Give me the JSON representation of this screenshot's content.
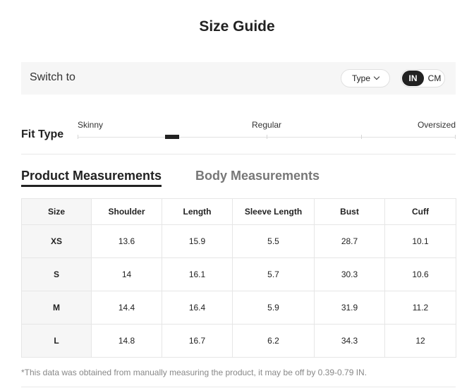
{
  "title": "Size Guide",
  "switch_bar": {
    "label": "Switch to",
    "type_button": "Type",
    "units": {
      "in": "IN",
      "cm": "CM",
      "selected": "IN"
    }
  },
  "fit_type": {
    "label": "Fit Type",
    "options": [
      "Skinny",
      "Regular",
      "Oversized"
    ],
    "selected_segment": 1,
    "segment_count": 4
  },
  "tabs": {
    "product": "Product Measurements",
    "body": "Body Measurements",
    "active": "product"
  },
  "table": {
    "headers": [
      "Size",
      "Shoulder",
      "Length",
      "Sleeve Length",
      "Bust",
      "Cuff"
    ],
    "rows": [
      [
        "XS",
        "13.6",
        "15.9",
        "5.5",
        "28.7",
        "10.1"
      ],
      [
        "S",
        "14",
        "16.1",
        "5.7",
        "30.3",
        "10.6"
      ],
      [
        "M",
        "14.4",
        "16.4",
        "5.9",
        "31.9",
        "11.2"
      ],
      [
        "L",
        "14.8",
        "16.7",
        "6.2",
        "34.3",
        "12"
      ]
    ]
  },
  "footnote": "*This data was obtained from manually measuring the product, it may be off by 0.39-0.79 IN."
}
